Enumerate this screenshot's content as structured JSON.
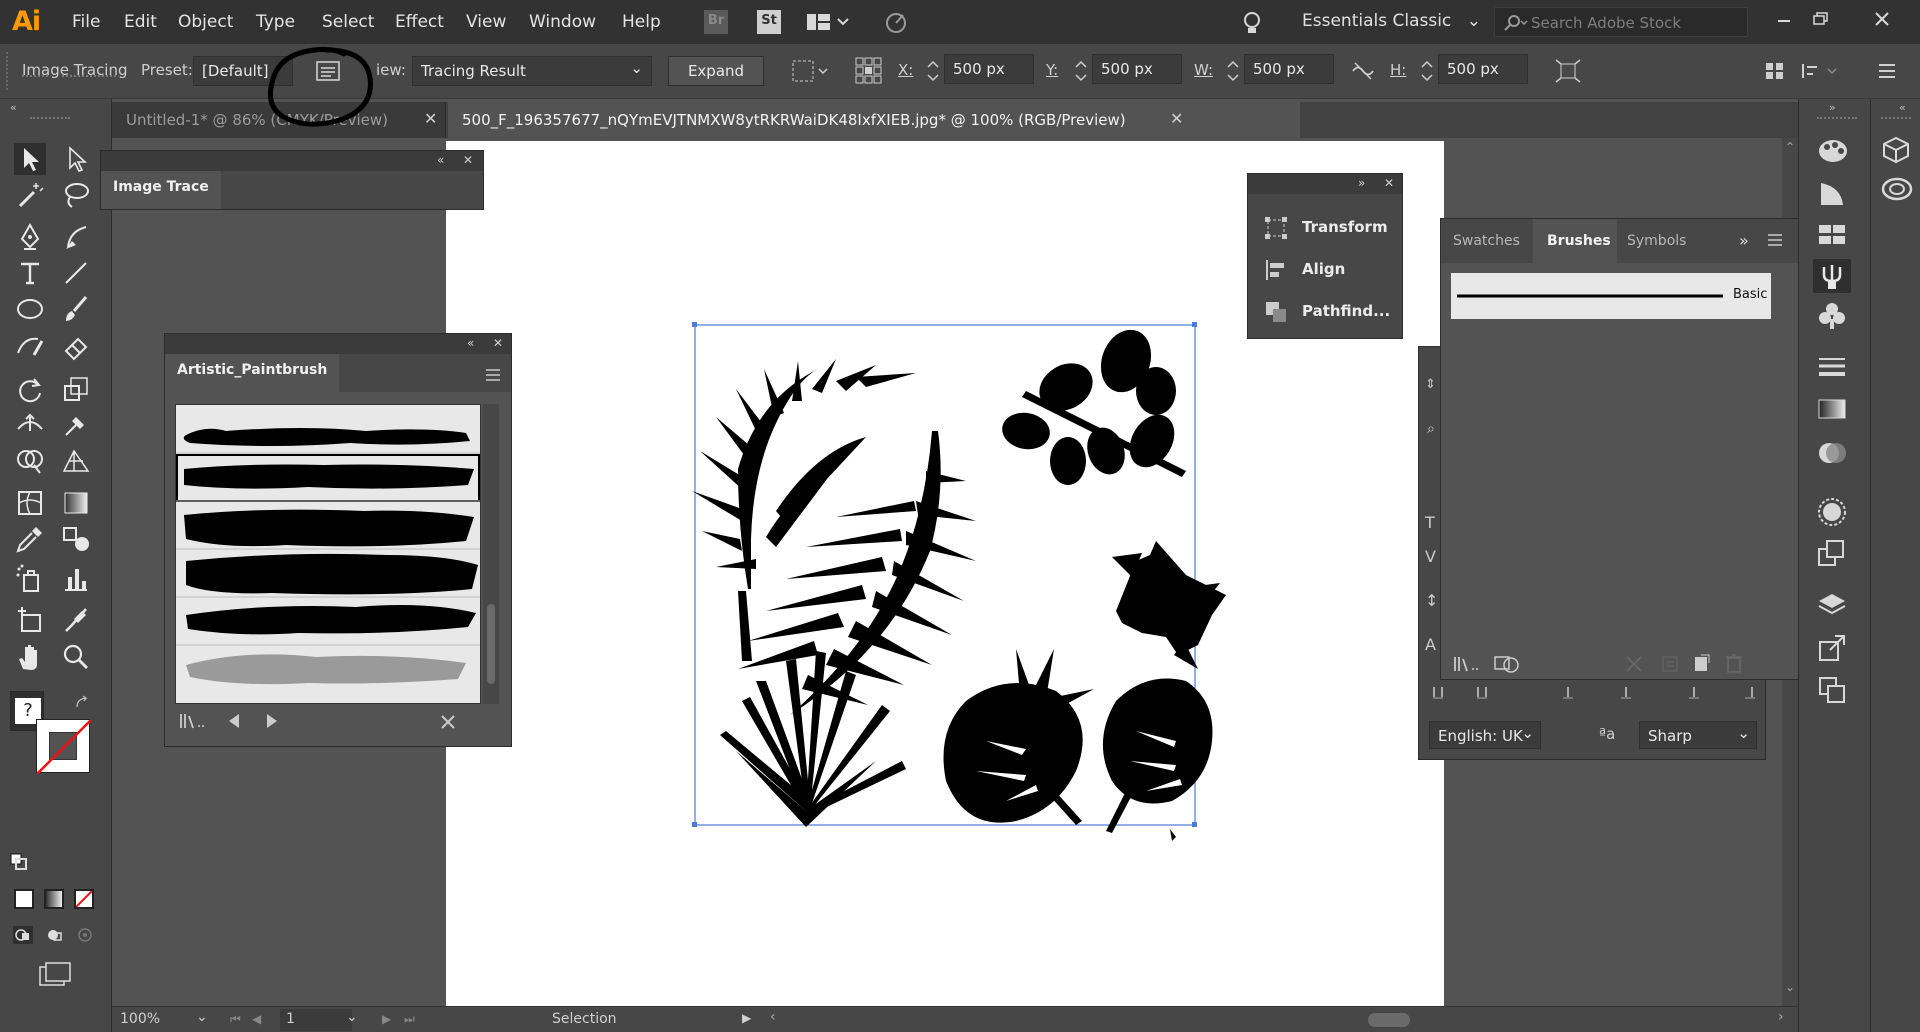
{
  "app": {
    "logo": "Ai",
    "menu": [
      "File",
      "Edit",
      "Object",
      "Type",
      "Select",
      "Effect",
      "View",
      "Window",
      "Help"
    ],
    "bridge_label": "Br",
    "stock_label": "St",
    "workspace": "Essentials Classic",
    "search_placeholder": "Search Adobe Stock"
  },
  "control_bar": {
    "panel_link": "Image Tracing",
    "preset_label": "Preset:",
    "preset_value": "[Default]",
    "view_label": "iew:",
    "view_value": "Tracing Result",
    "expand_button": "Expand",
    "x_label": "X:",
    "x_value": "500 px",
    "y_label": "Y:",
    "y_value": "500 px",
    "w_label": "W:",
    "w_value": "500 px",
    "h_label": "H:",
    "h_value": "500 px"
  },
  "tabs": [
    {
      "title": "Untitled-1* @ 86% (CMYK/Preview)",
      "active": false
    },
    {
      "title": "500_F_196357677_nQYmEVJTNMXW8ytRKRWaiDK48IxfXIEB.jpg* @ 100% (RGB/Preview)",
      "active": true
    }
  ],
  "image_trace_panel": {
    "title": "Image Trace"
  },
  "brush_library_panel": {
    "title": "Artistic_Paintbrush"
  },
  "floating_panel": {
    "items": [
      "Transform",
      "Align",
      "Pathfind..."
    ]
  },
  "brushes_panel": {
    "tabs": [
      "Swatches",
      "Brushes",
      "Symbols"
    ],
    "active_tab": "Brushes",
    "brush_name": "Basic"
  },
  "character_panel": {
    "language": "English: UK",
    "antialias": "Sharp"
  },
  "status_bar": {
    "zoom": "100%",
    "artboard_number": "1",
    "status_text": "Selection"
  },
  "colors": {
    "accent_logo": "#ff9a00",
    "annotation_circle": "#000000",
    "selection_bounds": "#4a7bd6"
  }
}
